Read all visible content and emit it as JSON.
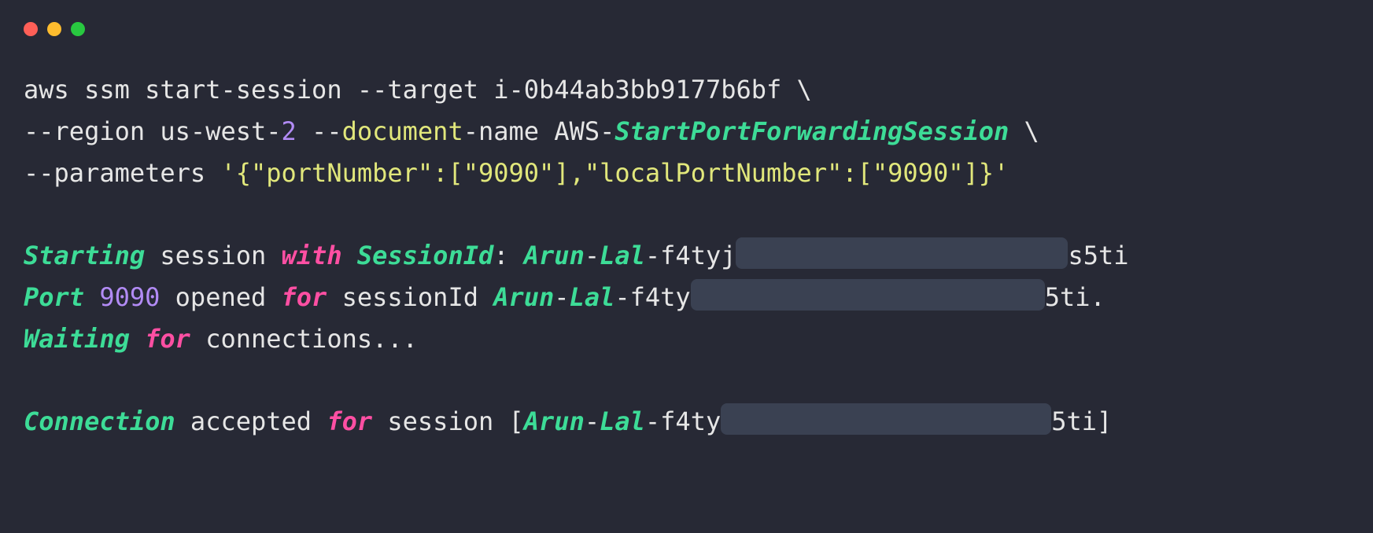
{
  "colors": {
    "background": "#272935",
    "foreground": "#e6e6e6",
    "yellow": "#e1e77b",
    "purple": "#b28bf5",
    "green": "#3ddc97",
    "magenta": "#ff4fa3",
    "mask": "#3a4152",
    "traffic_red": "#ff5f57",
    "traffic_yellow": "#febc2e",
    "traffic_green": "#28c840"
  },
  "cmd": {
    "l1_a": "aws ssm start-session ",
    "l1_b": "--",
    "l1_c": "target i-0b44ab3bb9177b6bf \\",
    "l2_a": "--",
    "l2_b": "region us-west-",
    "l2_c": "2",
    "l2_d": " ",
    "l2_e": "--",
    "l2_f": "document",
    "l2_g": "-name ",
    "l2_h": "AWS-",
    "l2_i": "StartPortForwardingSession",
    "l2_j": " \\",
    "l3_a": "--",
    "l3_b": "parameters ",
    "l3_c": "'{\"portNumber\":[\"9090\"],\"localPortNumber\":[\"9090\"]}'"
  },
  "out": {
    "l1_a": "Starting",
    "l1_b": " session ",
    "l1_c": "with",
    "l1_d": " ",
    "l1_e": "SessionId",
    "l1_f": ": ",
    "l1_g": "Arun",
    "l1_h": "-",
    "l1_i": "Lal",
    "l1_j": "-f4tyj",
    "l1_k": "s5ti",
    "l2_a": "Port",
    "l2_b": " ",
    "l2_c": "9090",
    "l2_d": " opened ",
    "l2_e": "for",
    "l2_f": " sessionId ",
    "l2_g": "Arun",
    "l2_h": "-",
    "l2_i": "Lal",
    "l2_j": "-f4ty",
    "l2_k": "5ti.",
    "l3_a": "Waiting",
    "l3_b": " ",
    "l3_c": "for",
    "l3_d": " connections...",
    "l4_a": "Connection",
    "l4_b": " accepted ",
    "l4_c": "for",
    "l4_d": " session [",
    "l4_e": "Arun",
    "l4_f": "-",
    "l4_g": "Lal",
    "l4_h": "-f4ty",
    "l4_i": "5ti]"
  }
}
